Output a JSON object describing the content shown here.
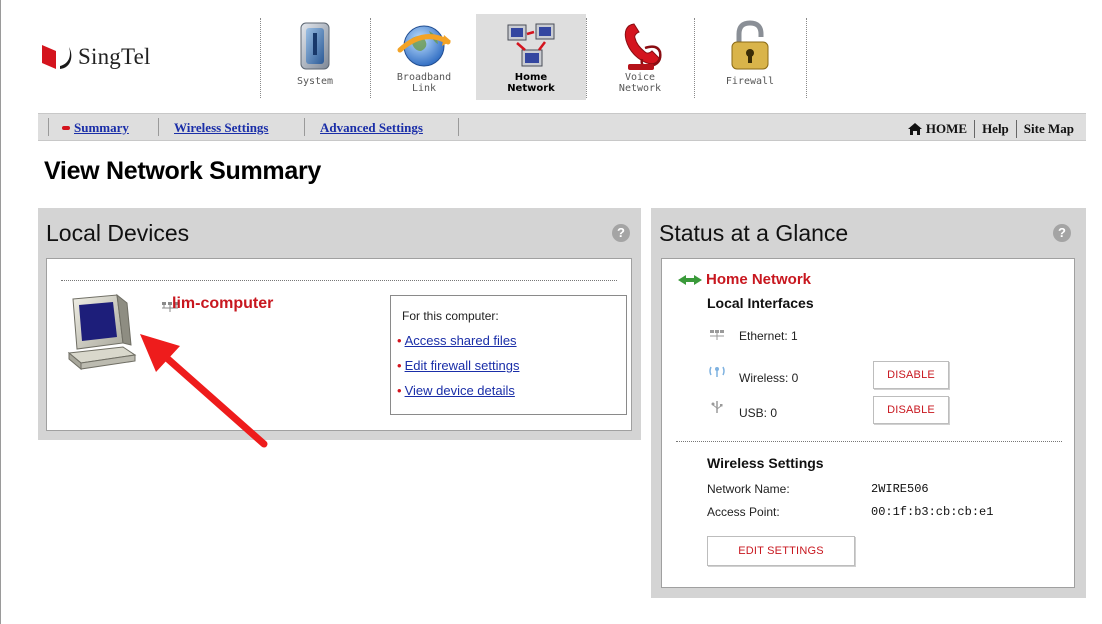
{
  "brand": {
    "name": "SingTel",
    "accent": "#d4141e"
  },
  "tabs": [
    {
      "label": "System",
      "icon": "system-icon",
      "active": false
    },
    {
      "label": "Broadband\nLink",
      "icon": "broadband-globe-icon",
      "active": false
    },
    {
      "label": "Home\nNetwork",
      "icon": "home-network-computers-icon",
      "active": true
    },
    {
      "label": "Voice\nNetwork",
      "icon": "telephone-icon",
      "active": false
    },
    {
      "label": "Firewall",
      "icon": "padlock-icon",
      "active": false
    }
  ],
  "subnav": {
    "items": [
      {
        "label": "Summary",
        "active": true
      },
      {
        "label": "Wireless Settings",
        "active": false
      },
      {
        "label": "Advanced Settings",
        "active": false
      }
    ],
    "right": {
      "home": "HOME",
      "help": "Help",
      "sitemap": "Site Map"
    }
  },
  "page": {
    "title": "View Network Summary"
  },
  "local_devices": {
    "title": "Local Devices",
    "device": {
      "name": "lim-computer",
      "icon": "computer-icon"
    },
    "box": {
      "heading": "For this computer:",
      "links": [
        "Access shared files",
        "Edit firewall settings",
        "View device details"
      ]
    }
  },
  "status": {
    "title": "Status at a Glance",
    "home_network": "Home Network",
    "local_interfaces": {
      "title": "Local Interfaces",
      "ethernet": "Ethernet: 1",
      "wireless": "Wireless: 0",
      "usb": "USB: 0",
      "disable_label": "DISABLE"
    },
    "wireless_settings": {
      "title": "Wireless Settings",
      "network_name_label": "Network Name:",
      "network_name": "2WIRE506",
      "access_point_label": "Access Point:",
      "access_point": "00:1f:b3:cb:cb:e1",
      "edit_label": "EDIT SETTINGS"
    },
    "help_glyph": "?"
  }
}
